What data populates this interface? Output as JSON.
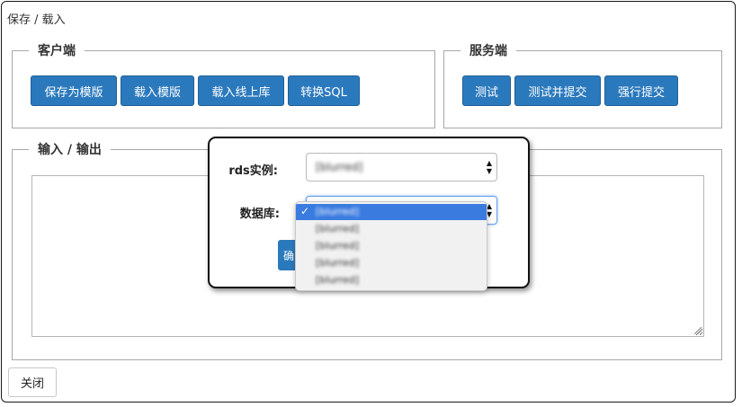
{
  "window": {
    "title": "保存 / 载入"
  },
  "client": {
    "legend": "客户端",
    "buttons": [
      "保存为模版",
      "载入模版",
      "载入线上库",
      "转换SQL"
    ]
  },
  "server": {
    "legend": "服务端",
    "buttons": [
      "测试",
      "测试并提交",
      "强行提交"
    ]
  },
  "io": {
    "legend": "输入 / 输出"
  },
  "footer": {
    "close_label": "关闭"
  },
  "modal": {
    "rds_label": "rds实例:",
    "db_label": "数据库:",
    "rds_value": "[blurred]",
    "db_value": "[blurred]",
    "confirm_label": "确"
  },
  "dropdown": {
    "options": [
      "[blurred]",
      "[blurred]",
      "[blurred]",
      "[blurred]",
      "[blurred]"
    ],
    "selected_index": 0
  },
  "colors": {
    "primary": "#2b79bd",
    "selection": "#3a7be0"
  }
}
